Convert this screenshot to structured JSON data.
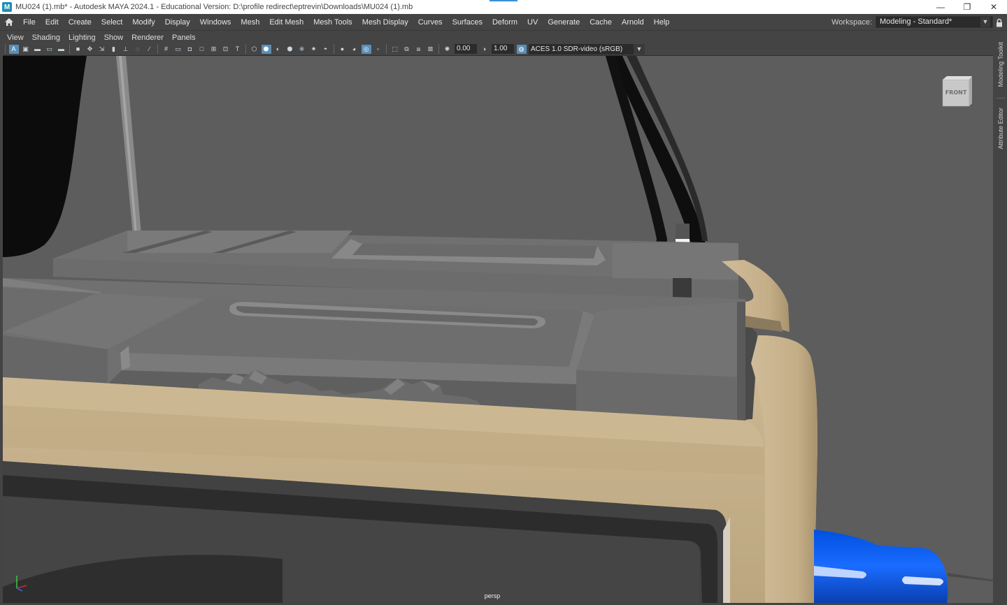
{
  "titlebar": {
    "app_icon": "M",
    "title": "MU024 (1).mb* - Autodesk MAYA 2024.1 - Educational Version: D:\\profile redirect\\eptrevin\\Downloads\\MU024 (1).mb",
    "minimize": "—",
    "restore": "❐",
    "close": "✕"
  },
  "menubar": {
    "items": [
      "File",
      "Edit",
      "Create",
      "Select",
      "Modify",
      "Display",
      "Windows",
      "Mesh",
      "Edit Mesh",
      "Mesh Tools",
      "Mesh Display",
      "Curves",
      "Surfaces",
      "Deform",
      "UV",
      "Generate",
      "Cache",
      "Arnold",
      "Help"
    ],
    "workspace_label": "Workspace:",
    "workspace_value": "Modeling - Standard*"
  },
  "panel_menu": {
    "items": [
      "View",
      "Shading",
      "Lighting",
      "Show",
      "Renderer",
      "Panels"
    ]
  },
  "panel_toolbar": {
    "exposure": "0.00",
    "gamma": "1.00",
    "color_space": "ACES 1.0 SDR-video (sRGB)"
  },
  "viewport": {
    "camera_label": "persp",
    "viewcube_face": "FRONT"
  },
  "side_tabs": {
    "modeling_toolkit": "Modeling Toolkit",
    "attribute_editor": "Attribute Editor"
  },
  "icons": {
    "home": "home-icon",
    "lock": "lock-icon",
    "axis": "axis-gizmo-icon"
  },
  "colors": {
    "viewport_bg": "#5d5d5d",
    "ui_bg": "#444444",
    "beige_frame": "#c5b08c",
    "blue_object": "#0a5ff5",
    "selection": "#5a8fb8"
  }
}
